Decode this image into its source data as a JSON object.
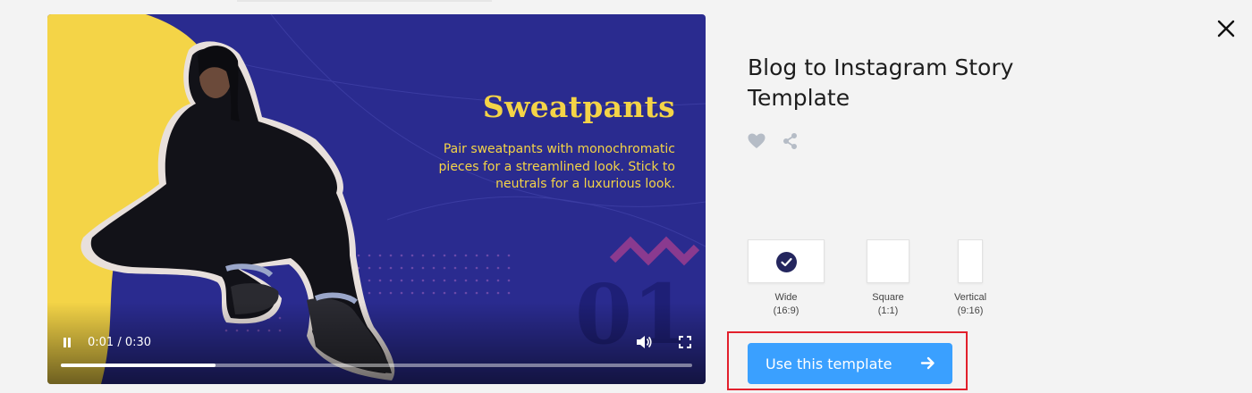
{
  "modal": {
    "title": "Blog to Instagram Story Template",
    "close_icon": "close-icon"
  },
  "preview": {
    "headline": "Sweatpants",
    "body": "Pair sweatpants with monochromatic pieces for a streamlined look. Stick to neutrals for a luxurious look.",
    "slide_number": "01",
    "colors": {
      "background": "#2a2b8f",
      "accent_yellow": "#f4d447",
      "zigzag": "#8a3a8f"
    }
  },
  "player": {
    "time": "0:01 / 0:30",
    "progress_fraction": 0.245,
    "pause_icon": "pause-icon",
    "volume_icon": "volume-icon",
    "fullscreen_icon": "fullscreen-icon"
  },
  "actions": {
    "like_icon": "heart-icon",
    "share_icon": "share-icon"
  },
  "formats": [
    {
      "label": "Wide",
      "ratio": "(16:9)",
      "selected": true
    },
    {
      "label": "Square",
      "ratio": "(1:1)",
      "selected": false
    },
    {
      "label": "Vertical",
      "ratio": "(9:16)",
      "selected": false
    }
  ],
  "cta": {
    "label": "Use this template",
    "icon": "arrow-right-icon",
    "color": "#3aa0ff"
  },
  "highlight_color": "#e2202c"
}
